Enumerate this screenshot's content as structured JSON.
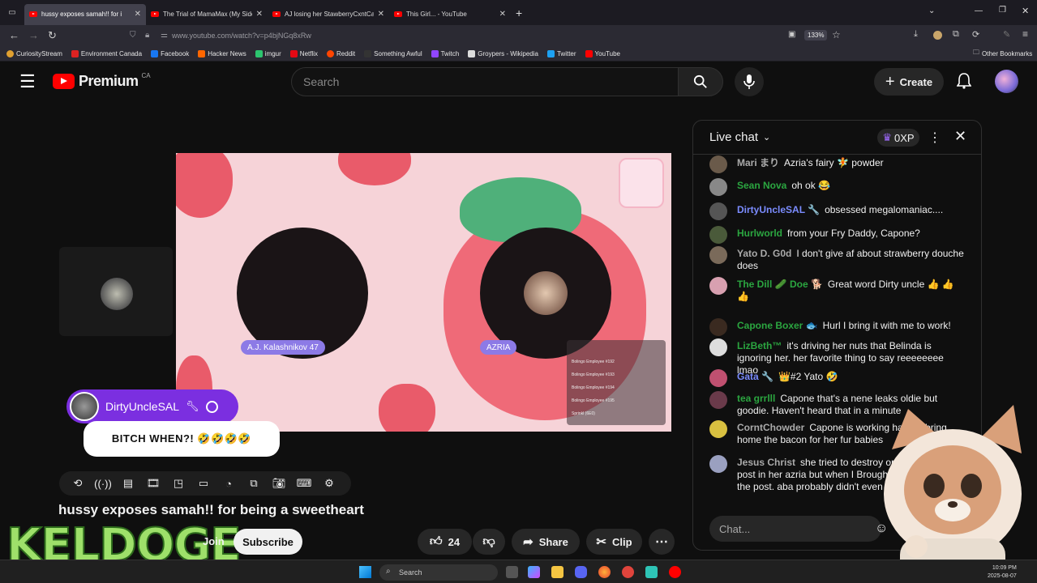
{
  "browser": {
    "tabs": [
      {
        "title": "hussy exposes samah!! for i",
        "active": true
      },
      {
        "title": "The Trial of MamaMax (My Side",
        "active": false
      },
      {
        "title": "AJ losing her StawberryCxntCa",
        "active": false
      },
      {
        "title": "This Girl... - YouTube",
        "active": false
      }
    ],
    "url": "www.youtube.com/watch?v=p4bjNGq8xRw",
    "zoom": "133%",
    "bookmarks": [
      "CuriosityStream",
      "Environment Canada",
      "Facebook",
      "Hacker News",
      "imgur",
      "Netflix",
      "Reddit",
      "Something Awful",
      "Twitch",
      "Groypers - Wikipedia",
      "Twitter",
      "YouTube"
    ],
    "other_bookmarks": "Other Bookmarks"
  },
  "youtube": {
    "logo_text": "Premium",
    "region": "CA",
    "search_placeholder": "Search",
    "create_label": "Create"
  },
  "video": {
    "left_name": "A.J. Kalashnikov 47",
    "right_name": "AZRIA",
    "superchat_user": "DirtyUncleSAL",
    "superchat_text": "BITCH WHEN?! 🤣🤣🤣🤣",
    "overlay_lines": [
      "Bolingo Employee #192",
      "Bolingo Employee #193",
      "Bolingo Employee #194",
      "Bolingo Employee #195",
      "Sprinkl (6E0)"
    ]
  },
  "meta": {
    "title": "hussy exposes samah!! for being a sweetheart",
    "join_label": "Join",
    "subscribe_label": "Subscribe",
    "likes": "24",
    "share_label": "Share",
    "clip_label": "Clip",
    "watermark": "KELDOGE"
  },
  "chat": {
    "header": "Live chat",
    "points": "0XP",
    "input_placeholder": "Chat...",
    "messages": [
      {
        "author": "Mari まり",
        "text": "Azria's fairy 🧚 powder",
        "color": "#aaaaaa",
        "avatar": "#6a5a4a"
      },
      {
        "author": "Sean Nova",
        "text": "oh ok 😂",
        "color": "#2ba640",
        "avatar": "#888888"
      },
      {
        "author": "DirtyUncleSAL 🔧",
        "text": "obsessed megalomaniac....",
        "color": "#7b8cff",
        "avatar": "#555555"
      },
      {
        "author": "Hurlworld",
        "text": "from your Fry Daddy, Capone?",
        "color": "#2ba640",
        "avatar": "#4a5a3a"
      },
      {
        "author": "Yato D. G0d",
        "text": "I don't give af about strawberry douche does",
        "color": "#aaaaaa",
        "avatar": "#7a6a5a"
      },
      {
        "author": "The Dill 🥒 Doe 🐕",
        "text": "Great word Dirty uncle 👍 👍👍",
        "color": "#2ba640",
        "avatar": "#d8a0b0"
      },
      {
        "author": "Capone Boxer 🐟",
        "text": "Hurl I bring it with me to work!",
        "color": "#2ba640",
        "avatar": "#3a2a20"
      },
      {
        "author": "LizBeth™",
        "text": "it's driving her nuts that Belinda is ignoring her. her favorite thing to say reeeeeeee lmao",
        "color": "#2ba640",
        "avatar": "#dddddd"
      },
      {
        "author": "Gata 🔧",
        "text": "👑#2 Yato 🤣",
        "color": "#7b8cff",
        "avatar": "#c05070"
      },
      {
        "author": "tea grrlll",
        "text": "Capone that's a nene leaks oldie but goodie. Haven't heard that in a minute",
        "color": "#2ba640",
        "avatar": "#6a3a4a"
      },
      {
        "author": "CorntChowder",
        "text": "Capone is working hard to bring home the bacon for her fur babies",
        "color": "#aaaaaa",
        "avatar": "#d8c040"
      },
      {
        "author": "Jesus Christ",
        "text": "she tried to destroy one community post in her azria but when I Brought it up she deleted the post. aba probably didn't even know",
        "color": "#aaaaaa",
        "avatar": "#9aa0c0"
      }
    ]
  },
  "taskbar": {
    "search_placeholder": "Search",
    "time": "10:09 PM",
    "date": "2025-08-07"
  },
  "colors": {
    "accent": "#ff0000",
    "superchat": "#7b2fe0",
    "chat_green": "#2ba640"
  }
}
